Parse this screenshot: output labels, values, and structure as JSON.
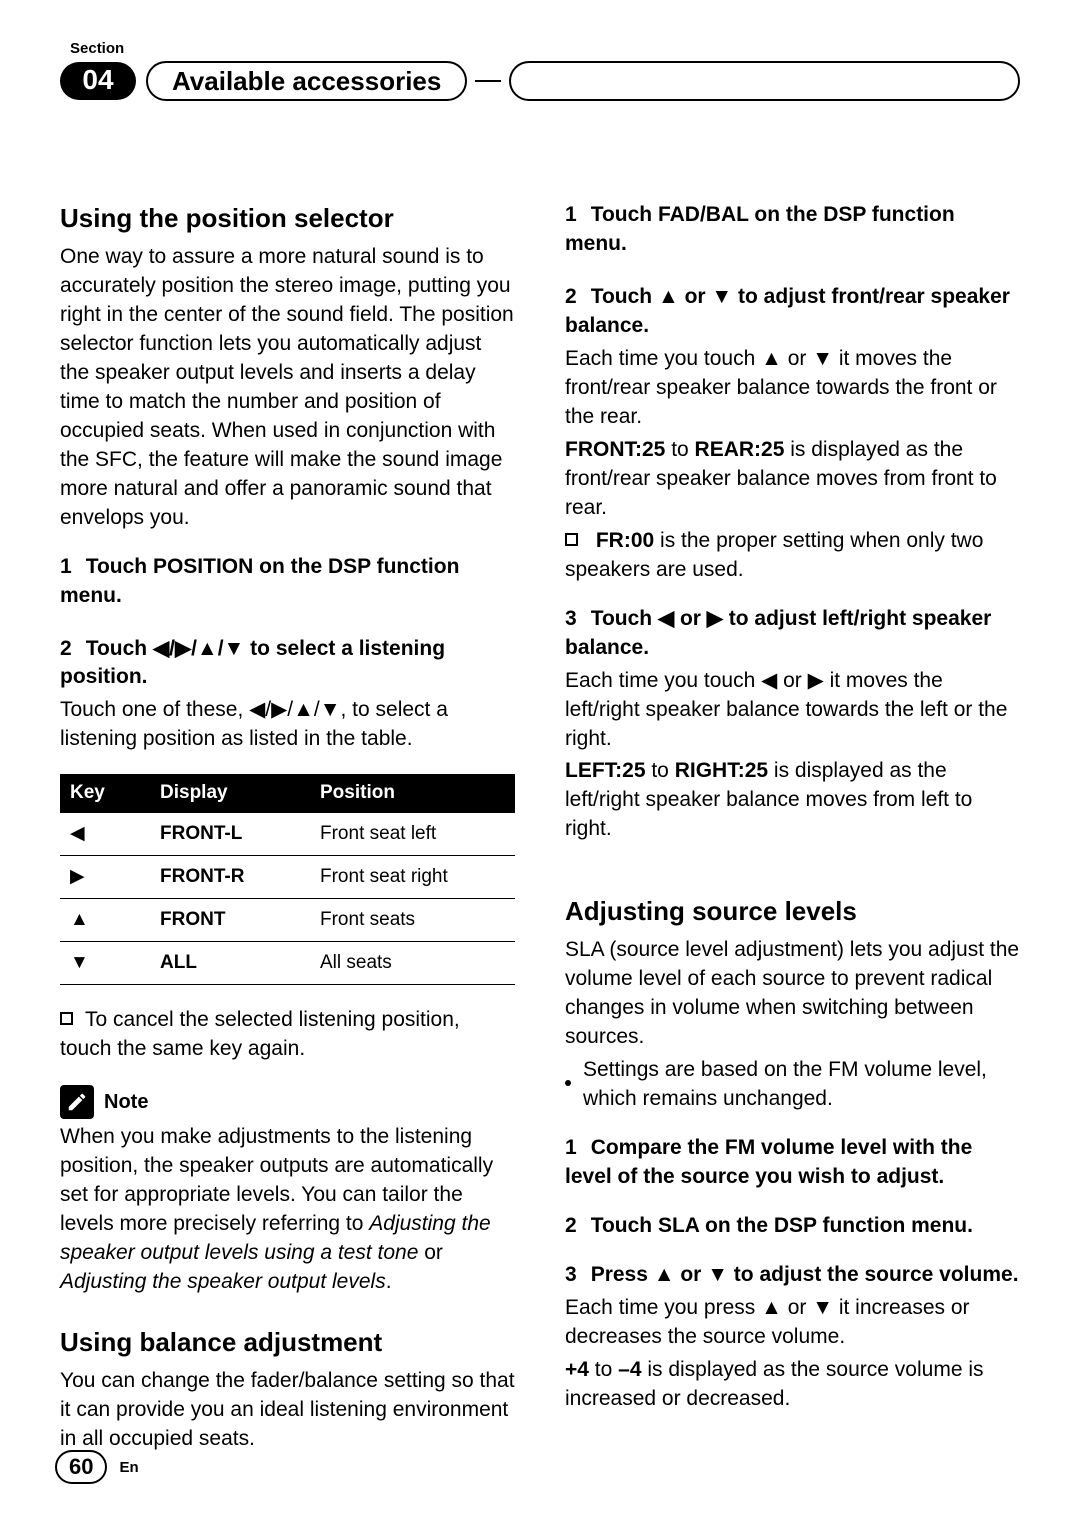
{
  "header": {
    "section_label": "Section",
    "number": "04",
    "title": "Available accessories"
  },
  "left": {
    "h1": "Using the position selector",
    "intro": "One way to assure a more natural sound is to accurately position the stereo image, putting you right in the center of the sound field. The position selector function lets you automatically adjust the speaker output levels and inserts a delay time to match the number and position of occupied seats. When used in conjunction with the SFC, the feature will make the sound image more natural and offer a panoramic sound that envelops you.",
    "step1_num": "1",
    "step1_text": "Touch POSITION on the DSP function menu.",
    "step2_num": "2",
    "step2_text_a": "Touch ◀/▶/▲/▼ to select a listening position.",
    "step2_body": "Touch one of these, ◀/▶/▲/▼, to select a listening position as listed in the table.",
    "table": {
      "headers": {
        "key": "Key",
        "display": "Display",
        "position": "Position"
      },
      "rows": [
        {
          "key": "◀",
          "display": "FRONT-L",
          "position": "Front seat left"
        },
        {
          "key": "▶",
          "display": "FRONT-R",
          "position": "Front seat right"
        },
        {
          "key": "▲",
          "display": "FRONT",
          "position": "Front seats"
        },
        {
          "key": "▼",
          "display": "ALL",
          "position": "All seats"
        }
      ]
    },
    "cancel_bullet": "To cancel the selected listening position, touch the same key again.",
    "note_label": "Note",
    "note_a": "When you make adjustments to the listening position, the speaker outputs are automatically set for appropriate levels. You can tailor the levels more precisely referring to ",
    "note_i1": "Adjusting the speaker output levels using a test tone",
    "note_mid": " or ",
    "note_i2": "Adjusting the speaker output levels",
    "note_end": ".",
    "h2": "Using balance adjustment",
    "balance_intro": "You can change the fader/balance setting so that it can provide you an ideal listening environment in all occupied seats."
  },
  "right": {
    "r_step1_num": "1",
    "r_step1_text": "Touch FAD/BAL on the DSP function menu.",
    "r_step2_num": "2",
    "r_step2_text": "Touch ▲ or ▼ to adjust front/rear speaker balance.",
    "r_step2_body": "Each time you touch ▲ or ▼ it moves the front/rear speaker balance towards the front or the rear.",
    "r_step2_range_a": "FRONT:25",
    "r_step2_range_mid": " to ",
    "r_step2_range_b": "REAR:25",
    "r_step2_range_tail": " is displayed as the front/rear speaker balance moves from front to rear.",
    "fr00_label": "FR:00",
    "fr00_tail": " is the proper setting when only two speakers are used.",
    "r_step3_num": "3",
    "r_step3_text": "Touch ◀ or ▶ to adjust left/right speaker balance.",
    "r_step3_body": "Each time you touch ◀ or ▶ it moves the left/right speaker balance towards the left or the right.",
    "r_step3_range_a": "LEFT:25",
    "r_step3_range_b": "RIGHT:25",
    "r_step3_range_tail": " is displayed as the left/right speaker balance moves from left to right.",
    "h3": "Adjusting source levels",
    "sla_intro": "SLA (source level adjustment) lets you adjust the volume level of each source to prevent radical changes in volume when switching between sources.",
    "sla_bullet": "Settings are based on the FM volume level, which remains unchanged.",
    "s_step1_num": "1",
    "s_step1_text": "Compare the FM volume level with the level of the source you wish to adjust.",
    "s_step2_num": "2",
    "s_step2_text": "Touch SLA on the DSP function menu.",
    "s_step3_num": "3",
    "s_step3_text": "Press ▲ or ▼ to adjust the source volume.",
    "s_step3_body": "Each time you press ▲ or ▼ it increases or decreases the source volume.",
    "s_range_a": "+4",
    "s_range_mid": " to ",
    "s_range_b": "–4",
    "s_range_tail": " is displayed as the source volume is increased or decreased."
  },
  "footer": {
    "page": "60",
    "lang": "En"
  }
}
